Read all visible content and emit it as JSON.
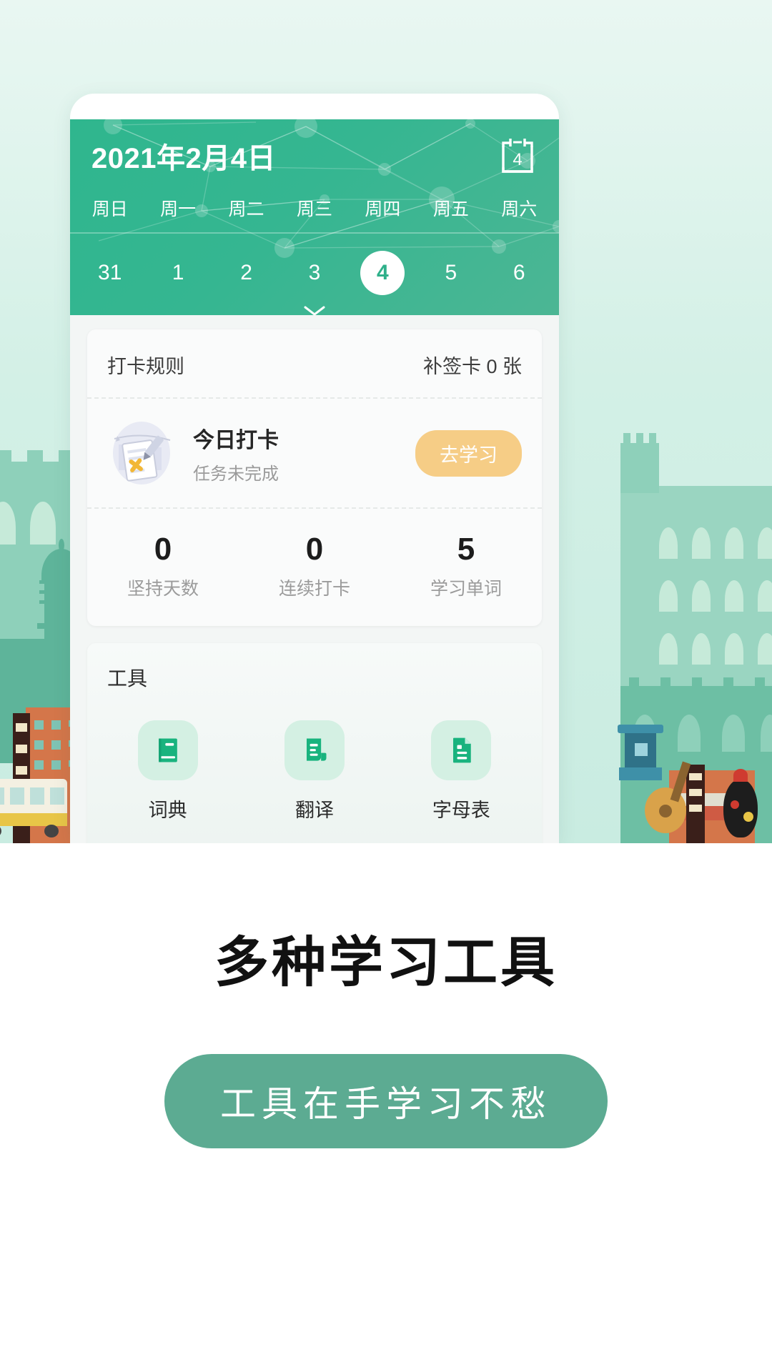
{
  "header": {
    "date_title": "2021年2月4日",
    "calendar_icon_day": "4",
    "weekdays": [
      "周日",
      "周一",
      "周二",
      "周三",
      "周四",
      "周五",
      "周六"
    ],
    "days": [
      "31",
      "1",
      "2",
      "3",
      "4",
      "5",
      "6"
    ],
    "selected_day": "4",
    "expand_icon": "chevron-down-icon",
    "accent_color": "#2fb68e"
  },
  "checkin_card": {
    "rules_label": "打卡规则",
    "makeup_label": "补签卡 0 张",
    "today_title": "今日打卡",
    "today_status": "任务未完成",
    "action_label": "去学习",
    "action_color": "#f6cd86",
    "stats": [
      {
        "value": "0",
        "label": "坚持天数"
      },
      {
        "value": "0",
        "label": "连续打卡"
      },
      {
        "value": "5",
        "label": "学习单词"
      }
    ]
  },
  "tools_card": {
    "title": "工具",
    "items": [
      {
        "label": "词典",
        "icon": "book-icon"
      },
      {
        "label": "翻译",
        "icon": "translate-document-icon"
      },
      {
        "label": "字母表",
        "icon": "document-icon"
      }
    ],
    "icon_color": "#19b37e",
    "icon_bg": "#d4f0e3"
  },
  "promo": {
    "headline": "多种学习工具",
    "pill_label": "工具在手学习不愁",
    "pill_color": "#5cab92"
  }
}
